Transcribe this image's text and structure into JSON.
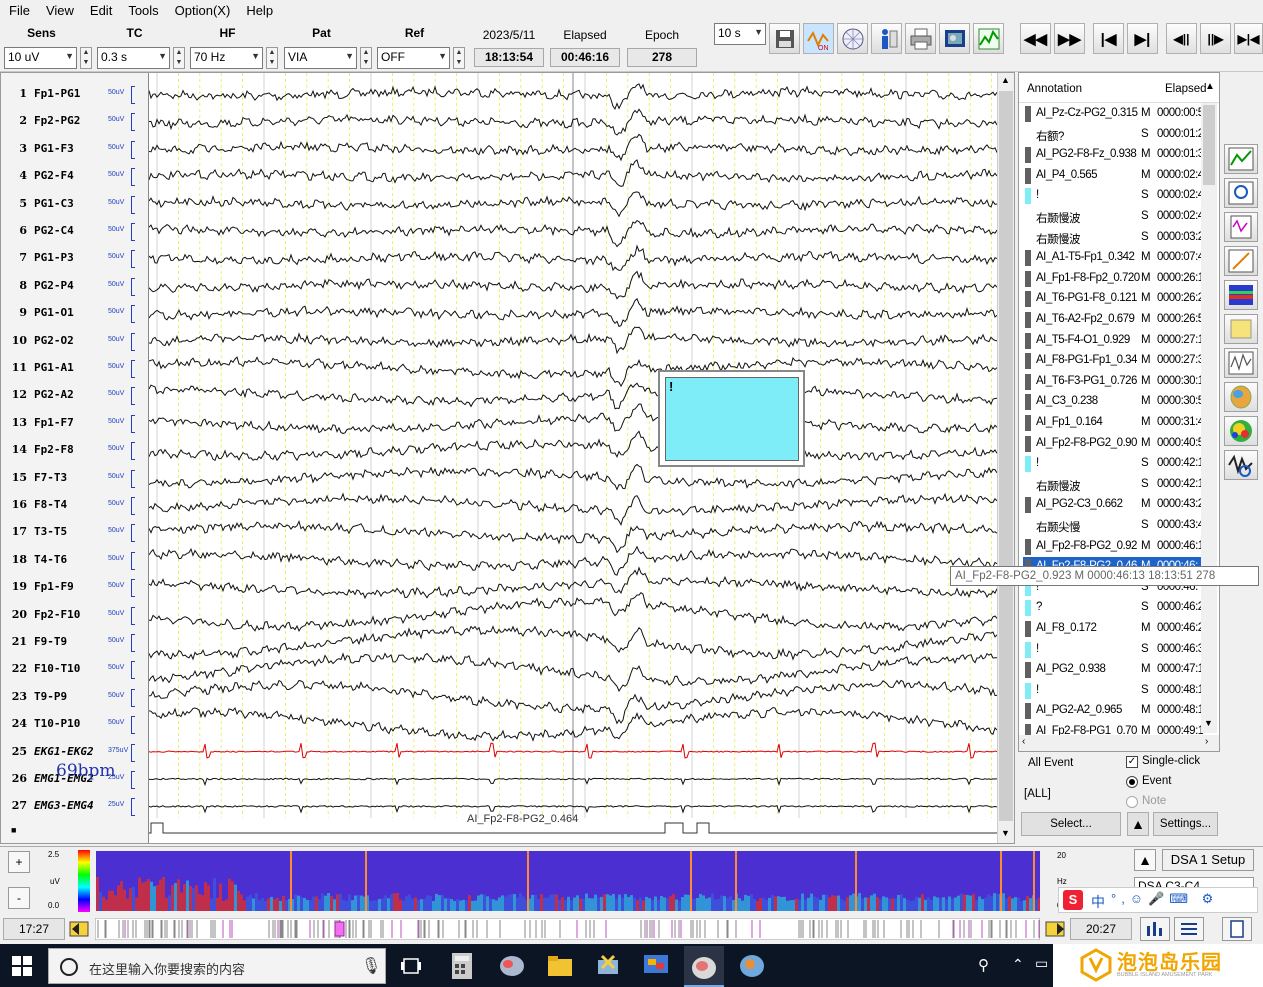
{
  "menu": [
    "File",
    "View",
    "Edit",
    "Tools",
    "Option(X)",
    "Help"
  ],
  "controls": {
    "sens": {
      "label": "Sens",
      "value": "10 uV"
    },
    "tc": {
      "label": "TC",
      "value": "0.3 s"
    },
    "hf": {
      "label": "HF",
      "value": "70 Hz"
    },
    "pat": {
      "label": "Pat",
      "value": "VIA"
    },
    "ref": {
      "label": "Ref",
      "value": "OFF"
    },
    "page": {
      "value": "10 s"
    }
  },
  "info": {
    "date": {
      "label": "2023/5/11",
      "value": "18:13:54"
    },
    "elapsed": {
      "label": "Elapsed",
      "value": "00:46:16"
    },
    "epoch": {
      "label": "Epoch",
      "value": "278"
    }
  },
  "channels": [
    {
      "num": "1",
      "name": "Fp1-PG1",
      "scale": "50uV"
    },
    {
      "num": "2",
      "name": "Fp2-PG2",
      "scale": "50uV"
    },
    {
      "num": "3",
      "name": "PG1-F3",
      "scale": "50uV"
    },
    {
      "num": "4",
      "name": "PG2-F4",
      "scale": "50uV"
    },
    {
      "num": "5",
      "name": "PG1-C3",
      "scale": "50uV"
    },
    {
      "num": "6",
      "name": "PG2-C4",
      "scale": "50uV"
    },
    {
      "num": "7",
      "name": "PG1-P3",
      "scale": "50uV"
    },
    {
      "num": "8",
      "name": "PG2-P4",
      "scale": "50uV"
    },
    {
      "num": "9",
      "name": "PG1-O1",
      "scale": "50uV"
    },
    {
      "num": "10",
      "name": "PG2-O2",
      "scale": "50uV"
    },
    {
      "num": "11",
      "name": "PG1-A1",
      "scale": "50uV"
    },
    {
      "num": "12",
      "name": "PG2-A2",
      "scale": "50uV"
    },
    {
      "num": "13",
      "name": "Fp1-F7",
      "scale": "50uV"
    },
    {
      "num": "14",
      "name": "Fp2-F8",
      "scale": "50uV"
    },
    {
      "num": "15",
      "name": "F7-T3",
      "scale": "50uV"
    },
    {
      "num": "16",
      "name": "F8-T4",
      "scale": "50uV"
    },
    {
      "num": "17",
      "name": "T3-T5",
      "scale": "50uV"
    },
    {
      "num": "18",
      "name": "T4-T6",
      "scale": "50uV"
    },
    {
      "num": "19",
      "name": "Fp1-F9",
      "scale": "50uV"
    },
    {
      "num": "20",
      "name": "Fp2-F10",
      "scale": "50uV"
    },
    {
      "num": "21",
      "name": "F9-T9",
      "scale": "50uV"
    },
    {
      "num": "22",
      "name": "F10-T10",
      "scale": "50uV"
    },
    {
      "num": "23",
      "name": "T9-P9",
      "scale": "50uV"
    },
    {
      "num": "24",
      "name": "T10-P10",
      "scale": "50uV"
    },
    {
      "num": "25",
      "name": "EKG1-EKG2",
      "scale": "375uV"
    },
    {
      "num": "26",
      "name": "EMG1-EMG2",
      "scale": "25uV"
    },
    {
      "num": "27",
      "name": "EMG3-EMG4",
      "scale": "25uV"
    }
  ],
  "heart_rate": "69bpm",
  "trace_annotation": "AI_Fp2-F8-PG2_0.464",
  "popup": {
    "text": "!"
  },
  "annotation_panel": {
    "col_annotation": "Annotation",
    "col_elapsed": "Elapsed",
    "rows": [
      {
        "text": "AI_Pz-Cz-PG2_0.315",
        "type": "M",
        "time": "0000:00:5",
        "mark": "#606060"
      },
      {
        "text": "右额?",
        "type": "S",
        "time": "0000:01:2",
        "mark": ""
      },
      {
        "text": "AI_PG2-F8-Fz_0.938",
        "type": "M",
        "time": "0000:01:3",
        "mark": "#606060"
      },
      {
        "text": "AI_P4_0.565",
        "type": "M",
        "time": "0000:02:4",
        "mark": "#606060"
      },
      {
        "text": "!",
        "type": "S",
        "time": "0000:02:4",
        "mark": "#7fedf8"
      },
      {
        "text": "右颞慢波",
        "type": "S",
        "time": "0000:02:4",
        "mark": ""
      },
      {
        "text": "右颞慢波",
        "type": "S",
        "time": "0000:03:2",
        "mark": ""
      },
      {
        "text": "AI_A1-T5-Fp1_0.342",
        "type": "M",
        "time": "0000:07:4",
        "mark": "#606060"
      },
      {
        "text": "AI_Fp1-F8-Fp2_0.720",
        "type": "M",
        "time": "0000:26:1",
        "mark": "#606060"
      },
      {
        "text": "AI_T6-PG1-F8_0.121",
        "type": "M",
        "time": "0000:26:2",
        "mark": "#606060"
      },
      {
        "text": "AI_T6-A2-Fp2_0.679",
        "type": "M",
        "time": "0000:26:5",
        "mark": "#606060"
      },
      {
        "text": "AI_T5-F4-O1_0.929",
        "type": "M",
        "time": "0000:27:1",
        "mark": "#606060"
      },
      {
        "text": "AI_F8-PG1-Fp1_0.34",
        "type": "M",
        "time": "0000:27:3",
        "mark": "#606060"
      },
      {
        "text": "AI_T6-F3-PG1_0.726",
        "type": "M",
        "time": "0000:30:1",
        "mark": "#606060"
      },
      {
        "text": "AI_C3_0.238",
        "type": "M",
        "time": "0000:30:5",
        "mark": "#606060"
      },
      {
        "text": "AI_Fp1_0.164",
        "type": "M",
        "time": "0000:31:4",
        "mark": "#606060"
      },
      {
        "text": "AI_Fp2-F8-PG2_0.90",
        "type": "M",
        "time": "0000:40:5",
        "mark": "#606060"
      },
      {
        "text": "!",
        "type": "S",
        "time": "0000:42:1",
        "mark": "#7fedf8"
      },
      {
        "text": "右颞慢波",
        "type": "S",
        "time": "0000:42:1",
        "mark": ""
      },
      {
        "text": "AI_PG2-C3_0.662",
        "type": "M",
        "time": "0000:43:2",
        "mark": "#606060"
      },
      {
        "text": "右颞尖慢",
        "type": "S",
        "time": "0000:43:4",
        "mark": ""
      },
      {
        "text": "AI_Fp2-F8-PG2_0.92",
        "type": "M",
        "time": "0000:46:1",
        "mark": "#606060"
      },
      {
        "text": "AI_Fp2-F8-PG2_0.46",
        "type": "M",
        "time": "0000:46:",
        "mark": "#606060",
        "selected": true
      },
      {
        "text": "!",
        "type": "S",
        "time": "0000:46:",
        "mark": "#7fedf8"
      },
      {
        "text": "?",
        "type": "S",
        "time": "0000:46:2",
        "mark": "#7fedf8"
      },
      {
        "text": "AI_F8_0.172",
        "type": "M",
        "time": "0000:46:2",
        "mark": "#606060"
      },
      {
        "text": "!",
        "type": "S",
        "time": "0000:46:3",
        "mark": "#7fedf8"
      },
      {
        "text": "AI_PG2_0.938",
        "type": "M",
        "time": "0000:47:1",
        "mark": "#606060"
      },
      {
        "text": "!",
        "type": "S",
        "time": "0000:48:1",
        "mark": "#7fedf8"
      },
      {
        "text": "AI_PG2-A2_0.965",
        "type": "M",
        "time": "0000:48:1",
        "mark": "#606060"
      },
      {
        "text": "AI_Fp2-F8-PG1_0.70",
        "type": "M",
        "time": "0000:49:1",
        "mark": "#606060"
      }
    ]
  },
  "tooltip": "AI_Fp2-F8-PG2_0.923   M   0000:46:13   18:13:51   278",
  "event_panel": {
    "all_event": "All Event",
    "all_value": "[ALL]",
    "single_click": "Single-click",
    "event": "Event",
    "note": "Note",
    "select_btn": "Select...",
    "settings_btn": "Settings..."
  },
  "dsa": {
    "scale_top": "2.5",
    "unit": "uV",
    "scale_bottom": "0.0",
    "hz_top": "20",
    "hz_unit": "Hz",
    "hz_bottom": "0",
    "setup_btn": "DSA 1 Setup",
    "channel_select": "DSA C3-C4"
  },
  "timeline": {
    "start": "17:27",
    "end": "20:27"
  },
  "taskbar": {
    "search_placeholder": "在这里输入你要搜索的内容",
    "ime": "中",
    "watermark": "泡泡岛乐园",
    "watermark_sub": "BUBBLE ISLAND AMUSEMENT PARK"
  },
  "colors": {
    "ekg": "#e00000",
    "selected": "#1d63c8",
    "popup": "#7fedf8",
    "grid": "#ecec40"
  }
}
